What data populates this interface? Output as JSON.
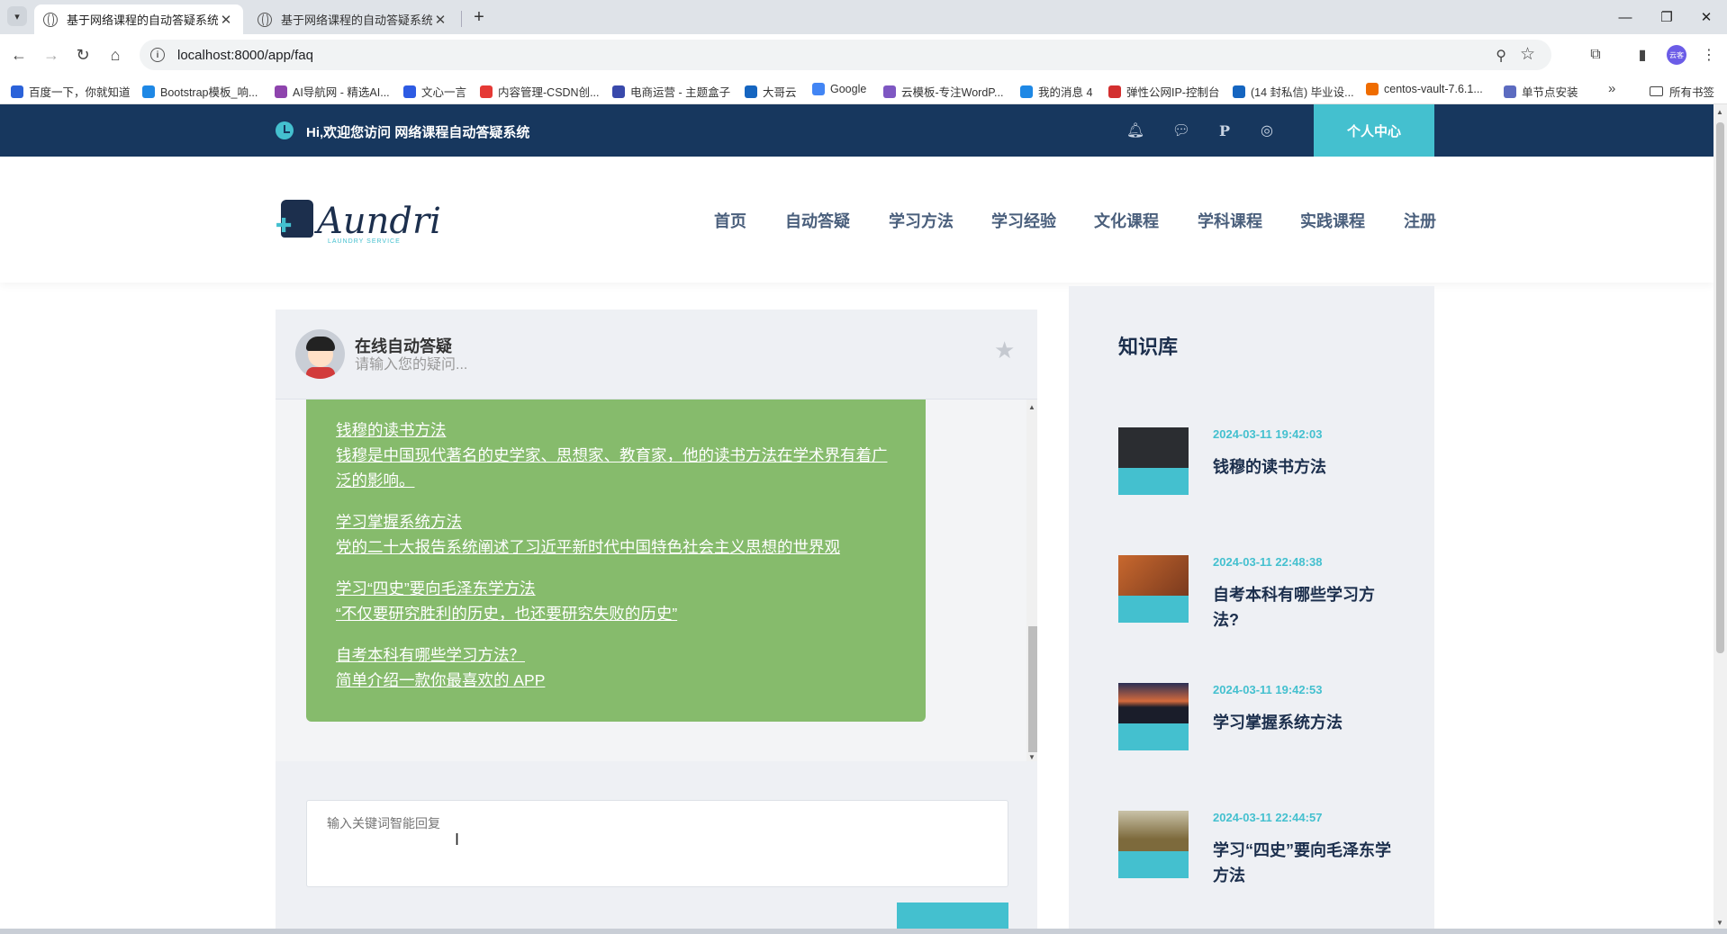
{
  "browser": {
    "tabs": [
      {
        "title": "基于网络课程的自动答疑系统",
        "active": true
      },
      {
        "title": "基于网络课程的自动答疑系统",
        "active": false
      }
    ],
    "url": "localhost:8000/app/faq",
    "bookmarks": [
      {
        "label": "百度一下，你就知道",
        "color": "#2b62d9"
      },
      {
        "label": "Bootstrap模板_响...",
        "color": "#1e88e5"
      },
      {
        "label": "AI导航网 - 精选AI...",
        "color": "#8e44ad"
      },
      {
        "label": "文心一言",
        "color": "#2d5be3"
      },
      {
        "label": "内容管理-CSDN创...",
        "color": "#e53935"
      },
      {
        "label": "电商运营 - 主题盒子",
        "color": "#3949ab"
      },
      {
        "label": "大哥云",
        "color": "#1565c0"
      },
      {
        "label": "Google",
        "color": "#4285f4"
      },
      {
        "label": "云模板-专注WordP...",
        "color": "#7e57c2"
      },
      {
        "label": "我的消息 4",
        "color": "#1e88e5"
      },
      {
        "label": "弹性公网IP-控制台",
        "color": "#d32f2f"
      },
      {
        "label": "(14 封私信) 毕业设...",
        "color": "#1565c0"
      },
      {
        "label": "centos-vault-7.6.1...",
        "color": "#ef6c00"
      },
      {
        "label": "单节点安装",
        "color": "#5c6bc0"
      }
    ],
    "bookmarks_folder": "所有书签",
    "profile_text": "云客"
  },
  "site": {
    "welcome": "Hi,欢迎您访问 网络课程自动答疑系统",
    "user_center": "个人中心",
    "logo_text": "Aundri",
    "logo_tagline": "LAUNDRY SERVICE",
    "nav": [
      "首页",
      "自动答疑",
      "学习方法",
      "学习经验",
      "文化课程",
      "学科课程",
      "实践课程",
      "注册"
    ],
    "social_icons": [
      "bell-icon",
      "wechat-icon",
      "pinterest-icon",
      "instagram-icon"
    ]
  },
  "chat": {
    "name": "在线自动答疑",
    "subtitle": "请输入您的疑问...",
    "qa": [
      {
        "q": "钱穆的读书方法",
        "a": "钱穆是中国现代著名的史学家、思想家、教育家，他的读书方法在学术界有着广泛的影响。"
      },
      {
        "q": "学习掌握系统方法",
        "a": "党的二十大报告系统阐述了习近平新时代中国特色社会主义思想的世界观"
      },
      {
        "q": "学习“四史”要向毛泽东学方法",
        "a": "“不仅要研究胜利的历史，也还要研究失败的历史”"
      },
      {
        "q": "自考本科有哪些学习方法？",
        "a": "简单介绍一款你最喜欢的 APP"
      }
    ],
    "input_placeholder": "输入关键词智能回复",
    "accent": "#44c0cf",
    "bubble_color": "#86bb6c"
  },
  "kb": {
    "title": "知识库",
    "items": [
      {
        "date": "2024-03-11 19:42:03",
        "title": "钱穆的读书方法",
        "img_color": "#2b2d31"
      },
      {
        "date": "2024-03-11 22:48:38",
        "title": "自考本科有哪些学习方法?",
        "img_color": "#a0532e"
      },
      {
        "date": "2024-03-11 19:42:53",
        "title": "学习掌握系统方法",
        "img_color": "#1f2233"
      },
      {
        "date": "2024-03-11 22:44:57",
        "title": "学习“四史”要向毛泽东学方法",
        "img_color": "#8c7a4a"
      }
    ]
  },
  "colors": {
    "topbar": "#17375e",
    "accent": "#44c0cf",
    "nav_text": "#4a5f7c"
  }
}
